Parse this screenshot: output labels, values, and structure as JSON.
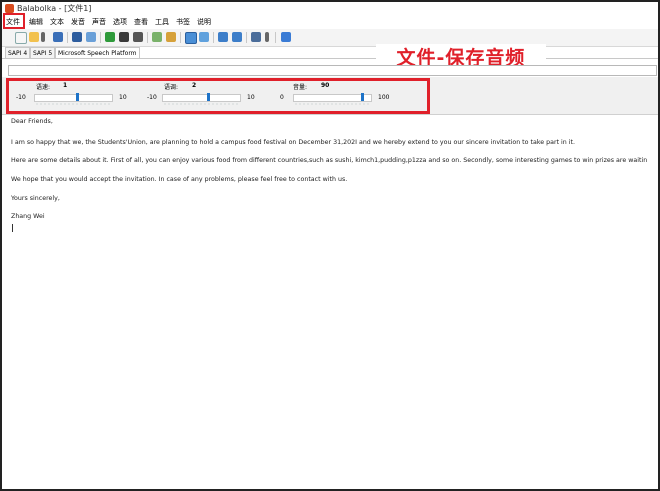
{
  "window": {
    "title": "Balabolka - [文件1]"
  },
  "menu": {
    "items": [
      "文件",
      "编辑",
      "文本",
      "发音",
      "声音",
      "选项",
      "查看",
      "工具",
      "书签",
      "说明"
    ]
  },
  "voice_tabs": [
    "SAPI 4",
    "SAPI 5",
    "Microsoft Speech Platform"
  ],
  "annotation": "文件-保存音频",
  "sliders": {
    "speed": {
      "label": "语速:",
      "value": "1",
      "min": "-10",
      "max": "10",
      "fraction": 0.55
    },
    "pitch": {
      "label": "语调:",
      "value": "2",
      "min": "-10",
      "max": "10",
      "fraction": 0.6
    },
    "volume": {
      "label": "音量:",
      "value": "90",
      "min": "0",
      "max": "100",
      "fraction": 0.9
    }
  },
  "document": {
    "lines": [
      "Dear Friends,",
      "I am so happy that we, the Students'Union, are planning to hold a campus food festival on December 31,202I and we hereby extend to you our sincere invitation to take part in it.",
      "Here are some details about it. First of all, you can enjoy various food from different countries,such as sushi, kimch1,pudding,p1zza and so on. Secondly, some interesting games to win prizes are waitin",
      "We hope that you would accept the invitation. In case of any problems, please feel free to contact with us.",
      "Yours sincerely,",
      "Zhang Wei"
    ]
  },
  "colors": {
    "accent": "#e0202a",
    "slider_thumb": "#1e73c8"
  }
}
